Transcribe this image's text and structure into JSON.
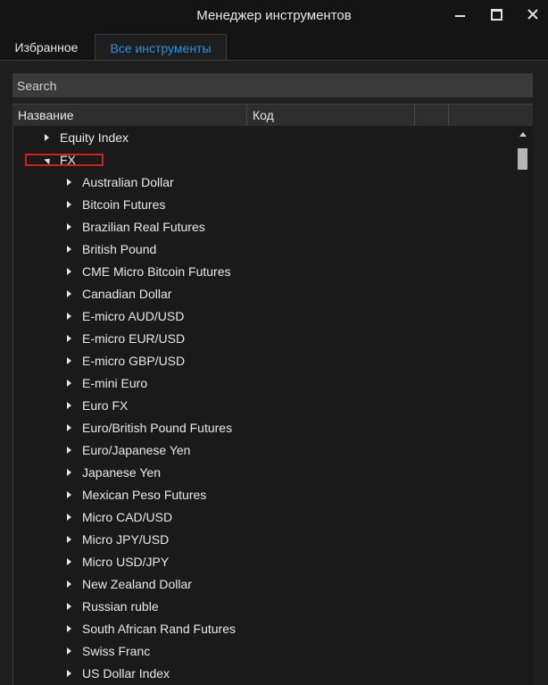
{
  "window": {
    "title": "Менеджер инструментов"
  },
  "tabs": [
    {
      "label": "Избранное",
      "active": false
    },
    {
      "label": "Все инструменты",
      "active": true
    }
  ],
  "search": {
    "placeholder": "Search",
    "value": ""
  },
  "columns": [
    "Название",
    "Код",
    "",
    ""
  ],
  "tree": {
    "top_items": [
      {
        "label": "Equity Index",
        "expanded": false
      },
      {
        "label": "FX",
        "expanded": true
      }
    ],
    "fx_children": [
      "Australian Dollar",
      "Bitcoin Futures",
      "Brazilian Real Futures",
      "British Pound",
      "CME Micro Bitcoin Futures",
      "Canadian Dollar",
      "E-micro AUD/USD",
      "E-micro EUR/USD",
      "E-micro GBP/USD",
      "E-mini Euro",
      "Euro FX",
      "Euro/British Pound Futures",
      "Euro/Japanese Yen",
      "Japanese Yen",
      "Mexican Peso Futures",
      "Micro CAD/USD",
      "Micro JPY/USD",
      "Micro USD/JPY",
      "New Zealand Dollar",
      "Russian ruble",
      "South African Rand Futures",
      "Swiss Franc",
      "US Dollar Index"
    ]
  },
  "colors": {
    "accent": "#2e8fe0",
    "highlight_box": "#d02020",
    "background": "#1e1e1e",
    "text": "#e6e6e6"
  },
  "icons": {
    "minimize": "minimize-icon",
    "maximize": "maximize-icon",
    "close": "close-icon",
    "collapsed": "caret-right-icon",
    "expanded": "caret-down-icon",
    "scroll_up": "scroll-up-arrow-icon"
  }
}
